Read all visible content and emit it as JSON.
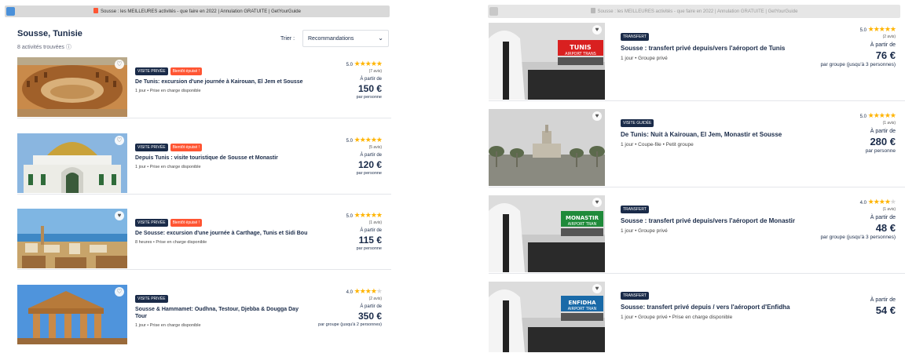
{
  "left_window": {
    "title": "Sousse : les MEILLEURES activités - que faire en 2022 | Annulation GRATUITE | GetYourGuide",
    "header": {
      "location": "Sousse, Tunisie",
      "count": "8 activités trouvées ⓘ"
    },
    "sort": {
      "label": "Trier :",
      "value": "Recommandations"
    },
    "cards": [
      {
        "badges": [
          "VISITE PRIVÉE",
          "Bientôt épuisé !"
        ],
        "title": "De Tunis: excursion d'une journée à Kairouan, El Jem et Sousse",
        "meta": "1 jour • Prise en charge disponible",
        "rating": "5.0",
        "stars": 5,
        "reviews": "(7 avis)",
        "from": "À partir de",
        "price": "150 €",
        "per": "par personne"
      },
      {
        "badges": [
          "VISITE PRIVÉE",
          "Bientôt épuisé !"
        ],
        "title": "Depuis Tunis : visite touristique de Sousse et Monastir",
        "meta": "1 jour • Prise en charge disponible",
        "rating": "5.0",
        "stars": 5,
        "reviews": "(5 avis)",
        "from": "À partir de",
        "price": "120 €",
        "per": "par personne"
      },
      {
        "badges": [
          "VISITE PRIVÉE",
          "Bientôt épuisé !"
        ],
        "title": "De Sousse: excursion d'une journée à Carthage, Tunis et Sidi Bou",
        "meta": "8 heures • Prise en charge disponible",
        "rating": "5.0",
        "stars": 5,
        "reviews": "(1 avis)",
        "from": "À partir de",
        "price": "115 €",
        "per": "par personne"
      },
      {
        "badges": [
          "VISITE PRIVÉE"
        ],
        "title": "Sousse & Hammamet: Oudhna, Testour, Djebba & Dougga Day Tour",
        "meta": "1 jour • Prise en charge disponible",
        "rating": "4.0",
        "stars": 4,
        "reviews": "(2 avis)",
        "from": "À partir de",
        "price": "350 €",
        "per": "par groupe (jusqu'à 2 personnes)"
      }
    ]
  },
  "right_window": {
    "title": "Sousse : les MEILLEURES activités - que faire en 2022 | Annulation GRATUITE | GetYourGuide",
    "cards": [
      {
        "badges": [
          "TRANSFERT"
        ],
        "title": "Sousse : transfert privé depuis/vers l'aéroport de Tunis",
        "meta": "1 jour • Groupe privé",
        "rating": "5.0",
        "stars": 5,
        "reviews": "(2 avis)",
        "from": "À partir de",
        "price": "76 €",
        "per": "par groupe (jusqu'à 3 personnes)",
        "sign": "TUNIS",
        "sign_sub": "AIRPORT TRANS"
      },
      {
        "badges": [
          "VISITE GUIDÉE"
        ],
        "title": "De Tunis: Nuit à Kairouan, El Jem, Monastir et Sousse",
        "meta": "1 jour • Coupe-file • Petit groupe",
        "rating": "5.0",
        "stars": 5,
        "reviews": "(1 avis)",
        "from": "À partir de",
        "price": "280 €",
        "per": "par personne"
      },
      {
        "badges": [
          "TRANSFERT"
        ],
        "title": "Sousse : transfert privé depuis/vers l'aéroport de Monastir",
        "meta": "1 jour • Groupe privé",
        "rating": "4.0",
        "stars": 4,
        "reviews": "(1 avis)",
        "from": "À partir de",
        "price": "48 €",
        "per": "par groupe (jusqu'à 3 personnes)",
        "sign": "MONASTIR",
        "sign_sub": "AIRPORT TRAN"
      },
      {
        "badges": [
          "TRANSFERT"
        ],
        "title": "Sousse: transfert privé depuis / vers l'aéroport d'Enfidha",
        "meta": "1 jour • Groupe privé • Prise en charge disponible",
        "from": "À partir de",
        "price": "54 €",
        "sign": "ENFIDHA",
        "sign_sub": "AIRPORT TRAN"
      }
    ]
  },
  "colors": {
    "navy": "#1a2b49",
    "badge_hot": "#ff5533",
    "star": "#ffb400"
  }
}
